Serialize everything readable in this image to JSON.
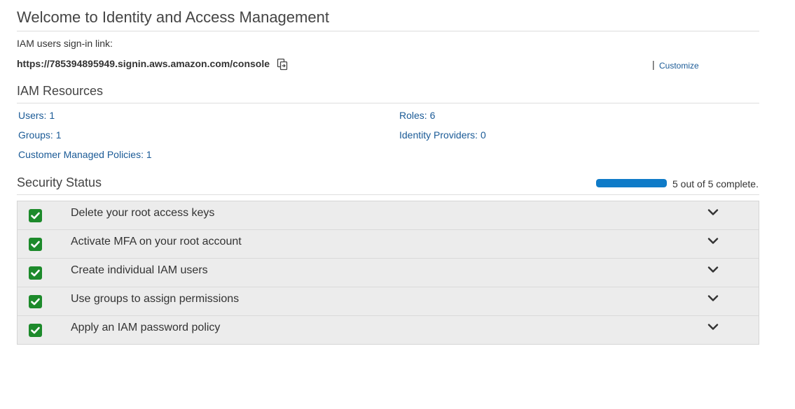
{
  "header": {
    "title": "Welcome to Identity and Access Management"
  },
  "signin": {
    "label": "IAM users sign-in link:",
    "url": "https://785394895949.signin.aws.amazon.com/console",
    "separator": "|",
    "customize_label": "Customize"
  },
  "resources": {
    "title": "IAM Resources",
    "items": [
      {
        "label": "Users: 1"
      },
      {
        "label": "Roles: 6"
      },
      {
        "label": "Groups: 1"
      },
      {
        "label": "Identity Providers: 0"
      },
      {
        "label": "Customer Managed Policies: 1"
      }
    ]
  },
  "security": {
    "title": "Security Status",
    "progress_complete": 5,
    "progress_total": 5,
    "progress_text": "5 out of 5 complete.",
    "items": [
      {
        "label": "Delete your root access keys",
        "status": "complete"
      },
      {
        "label": "Activate MFA on your root account",
        "status": "complete"
      },
      {
        "label": "Create individual IAM users",
        "status": "complete"
      },
      {
        "label": "Use groups to assign permissions",
        "status": "complete"
      },
      {
        "label": "Apply an IAM password policy",
        "status": "complete"
      }
    ]
  },
  "colors": {
    "link": "#1a5a96",
    "check": "#1d8a2b",
    "progress": "#0f7bc8"
  },
  "icons": {
    "copy": "copy-icon",
    "check": "check-icon",
    "expand": "chevron-down-icon"
  }
}
